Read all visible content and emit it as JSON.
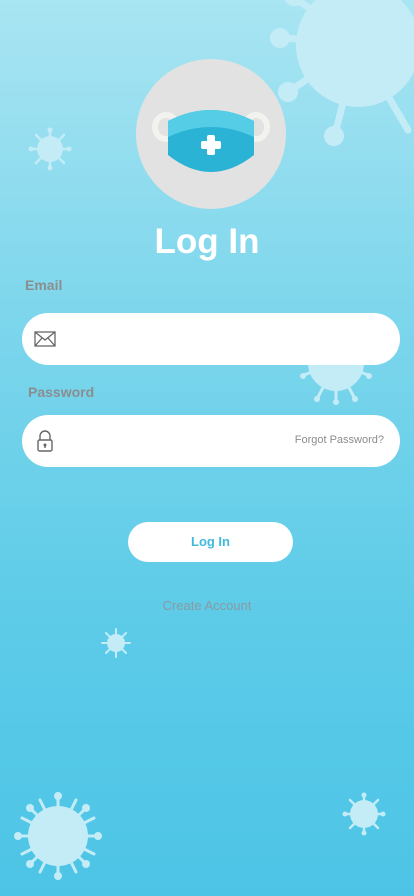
{
  "title": "Log In",
  "email": {
    "label": "Email",
    "placeholder": ""
  },
  "password": {
    "label": "Password",
    "placeholder": "",
    "forgot": "Forgot Password?"
  },
  "login_button": "Log In",
  "create_account": "Create Account",
  "icons": {
    "logo": "face-mask-icon",
    "email": "envelope-icon",
    "password": "padlock-icon",
    "decor": "virus-icon"
  },
  "colors": {
    "background_top": "#a9e5f2",
    "background_bottom": "#4dc4e6",
    "mask": "#2bb3d6",
    "button_text": "#3fb9dc",
    "virus_decor": "#c4ecf6"
  }
}
